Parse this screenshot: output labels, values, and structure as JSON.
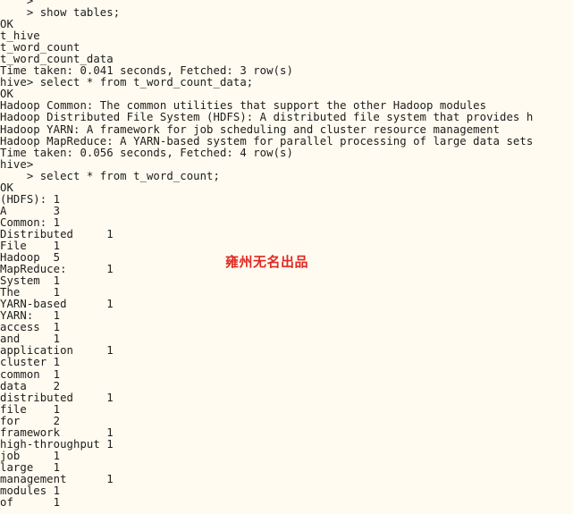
{
  "terminal": {
    "app": "hive-cli",
    "background_color": "#FFFBF0",
    "text_color": "#1c1c1c",
    "tab_width": 8,
    "lines": [
      "    > ",
      "    > show tables;",
      "OK",
      "t_hive",
      "t_word_count",
      "t_word_count_data",
      "Time taken: 0.041 seconds, Fetched: 3 row(s)",
      "hive> select * from t_word_count_data;",
      "OK",
      "Hadoop Common: The common utilities that support the other Hadoop modules",
      "Hadoop Distributed File System (HDFS): A distributed file system that provides h",
      "Hadoop YARN: A framework for job scheduling and cluster resource management",
      "Hadoop MapReduce: A YARN-based system for parallel processing of large data sets",
      "Time taken: 0.056 seconds, Fetched: 4 row(s)",
      "hive>",
      "    > select * from t_word_count;",
      "OK",
      "(HDFS):\t1",
      "A\t3",
      "Common:\t1",
      "Distributed\t1",
      "File\t1",
      "Hadoop\t5",
      "MapReduce:\t1",
      "System\t1",
      "The\t1",
      "YARN-based\t1",
      "YARN:\t1",
      "access\t1",
      "and\t1",
      "application\t1",
      "cluster\t1",
      "common\t1",
      "data\t2",
      "distributed\t1",
      "file\t1",
      "for\t2",
      "framework\t1",
      "high-throughput\t1",
      "job\t1",
      "large\t1",
      "management\t1",
      "modules\t1",
      "of\t1"
    ]
  },
  "watermark": {
    "text": "雍州无名出品",
    "color": "#E02A22"
  }
}
